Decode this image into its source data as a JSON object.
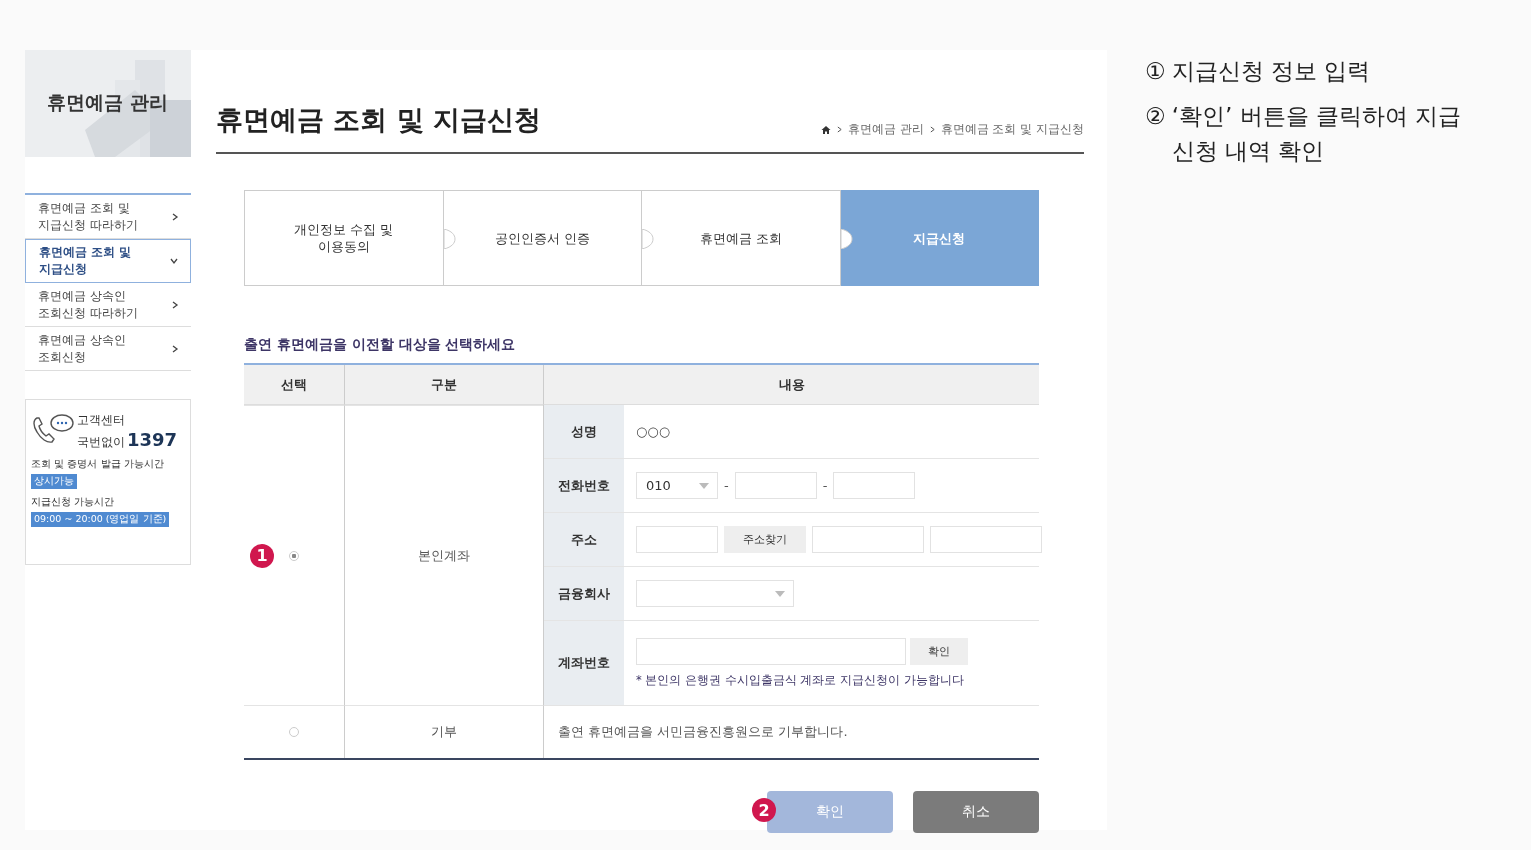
{
  "sidebar": {
    "title": "휴면예금 관리",
    "items": [
      {
        "lines": [
          "휴면예금 조회 및",
          "지급신청 따라하기"
        ],
        "selected": false,
        "expanded": false
      },
      {
        "lines": [
          "휴면예금 조회 및",
          "지급신청"
        ],
        "selected": true,
        "expanded": true
      },
      {
        "lines": [
          "휴면예금 상속인",
          "조회신청 따라하기"
        ],
        "selected": false,
        "expanded": false
      },
      {
        "lines": [
          "휴면예금 상속인",
          "조회신청"
        ],
        "selected": false,
        "expanded": false
      }
    ],
    "contact": {
      "label": "고객센터",
      "prefix": "국번없이",
      "number": "1397",
      "hours": [
        {
          "title": "조회 및 증명서 발급 가능시간",
          "value": "상시가능"
        },
        {
          "title": "지급신청 가능시간",
          "value": "09:00 ~ 20:00 (영업일 기준)"
        }
      ]
    }
  },
  "page": {
    "title": "휴면예금 조회 및 지급신청",
    "breadcrumb": [
      "휴면예금 관리",
      "휴면예금 조회 및 지급신청"
    ]
  },
  "steps": [
    {
      "lines": [
        "개인정보 수집 및",
        "이용동의"
      ],
      "selected": false
    },
    {
      "lines": [
        "공인인증서 인증"
      ],
      "selected": false
    },
    {
      "lines": [
        "휴면예금 조회"
      ],
      "selected": false
    },
    {
      "lines": [
        "지급신청"
      ],
      "selected": true
    }
  ],
  "section_title": "출연 휴면예금을 이전할 대상을 선택하세요",
  "table": {
    "columns": [
      "선택",
      "구분",
      "내용"
    ],
    "rows": [
      {
        "selected": true,
        "marker": "1",
        "category": "본인계좌",
        "fields": [
          {
            "kind": "text",
            "label": "성명",
            "value": "○○○"
          },
          {
            "kind": "phone",
            "label": "전화번호",
            "value": "010",
            "separators": [
              "-",
              "-"
            ]
          },
          {
            "kind": "address",
            "label": "주소",
            "button": "주소찾기"
          },
          {
            "kind": "select",
            "label": "금융회사"
          },
          {
            "kind": "account",
            "label": "계좌번호",
            "button": "확인",
            "note": "* 본인의 은행권 수시입출금식 계좌로 지급신청이 가능합니다"
          }
        ]
      },
      {
        "selected": false,
        "category": "기부",
        "content": "출연 휴면예금을 서민금융진흥원으로 기부합니다."
      }
    ]
  },
  "buttons": [
    {
      "label": "확인",
      "kind": "primary",
      "marker": "2"
    },
    {
      "label": "취소",
      "kind": "secondary"
    }
  ],
  "notes": [
    {
      "number": "①",
      "text": "지급신청 정보 입력"
    },
    {
      "number": "②",
      "text": "‘확인’ 버튼을 클릭하여 지급 신청 내역 확인"
    }
  ]
}
